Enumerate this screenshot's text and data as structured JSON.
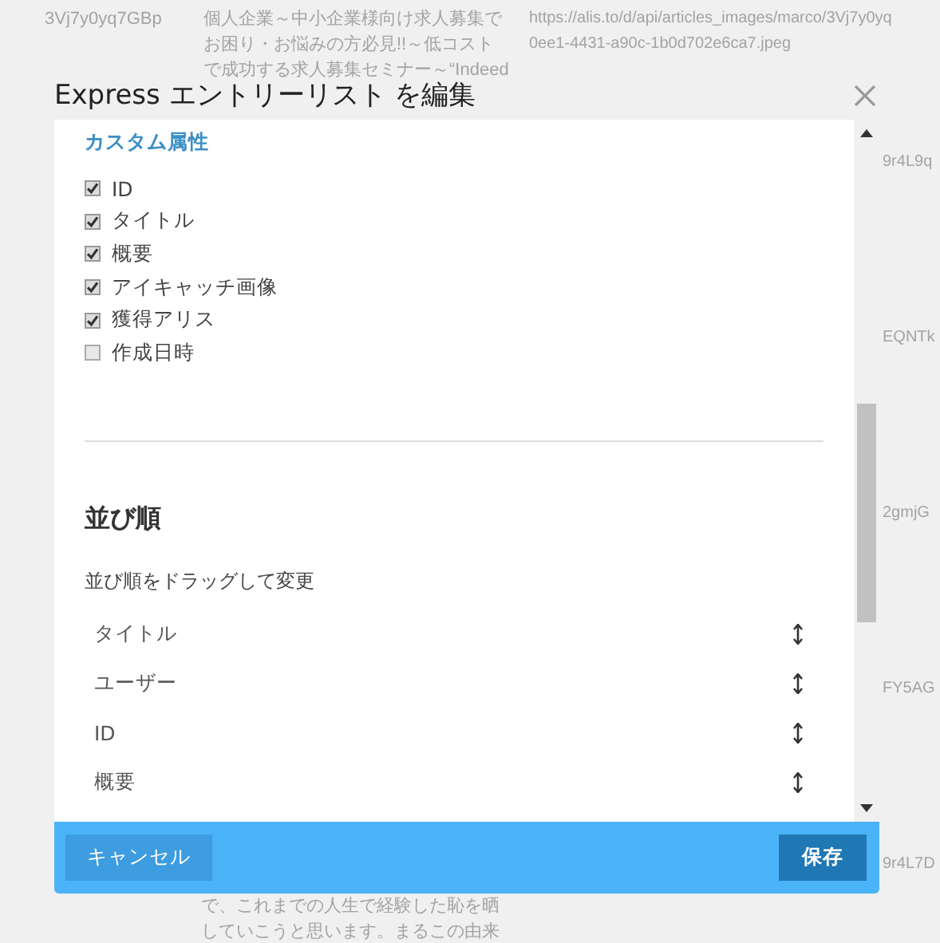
{
  "background": {
    "top_row": [
      [
        "3Vj7y0yq7GBp"
      ],
      [
        "個人企業～中小企業様向け求人募集で",
        "お困り・お悩みの方必見!!～低コスト",
        "で成功する求人募集セミナー～“Indeed"
      ],
      [
        "https://alis.to/d/api/articles_images/marco/3Vj7y0yq",
        "0ee1-4431-a90c-1b0d702e6ca7.jpeg"
      ]
    ],
    "side_ids": [
      "9r4L9q",
      "EQNTk",
      "2gmjG",
      "FY5AG",
      "9r4L7D"
    ],
    "bottom_text": [
      "で、これまでの人生で経験した恥を晒",
      "していこうと思います。まるこの由来"
    ]
  },
  "dialog": {
    "title": "Express エントリーリスト を編集",
    "custom_attributes": {
      "heading": "カスタム属性",
      "items": [
        {
          "label": "ID",
          "checked": true
        },
        {
          "label": "タイトル",
          "checked": true
        },
        {
          "label": "概要",
          "checked": true
        },
        {
          "label": "アイキャッチ画像",
          "checked": true
        },
        {
          "label": "獲得アリス",
          "checked": true
        },
        {
          "label": "作成日時",
          "checked": false
        }
      ]
    },
    "sort": {
      "heading": "並び順",
      "description": "並び順をドラッグして変更",
      "items": [
        "タイトル",
        "ユーザー",
        "ID",
        "概要"
      ]
    },
    "buttons": {
      "cancel": "キャンセル",
      "save": "保存"
    }
  }
}
